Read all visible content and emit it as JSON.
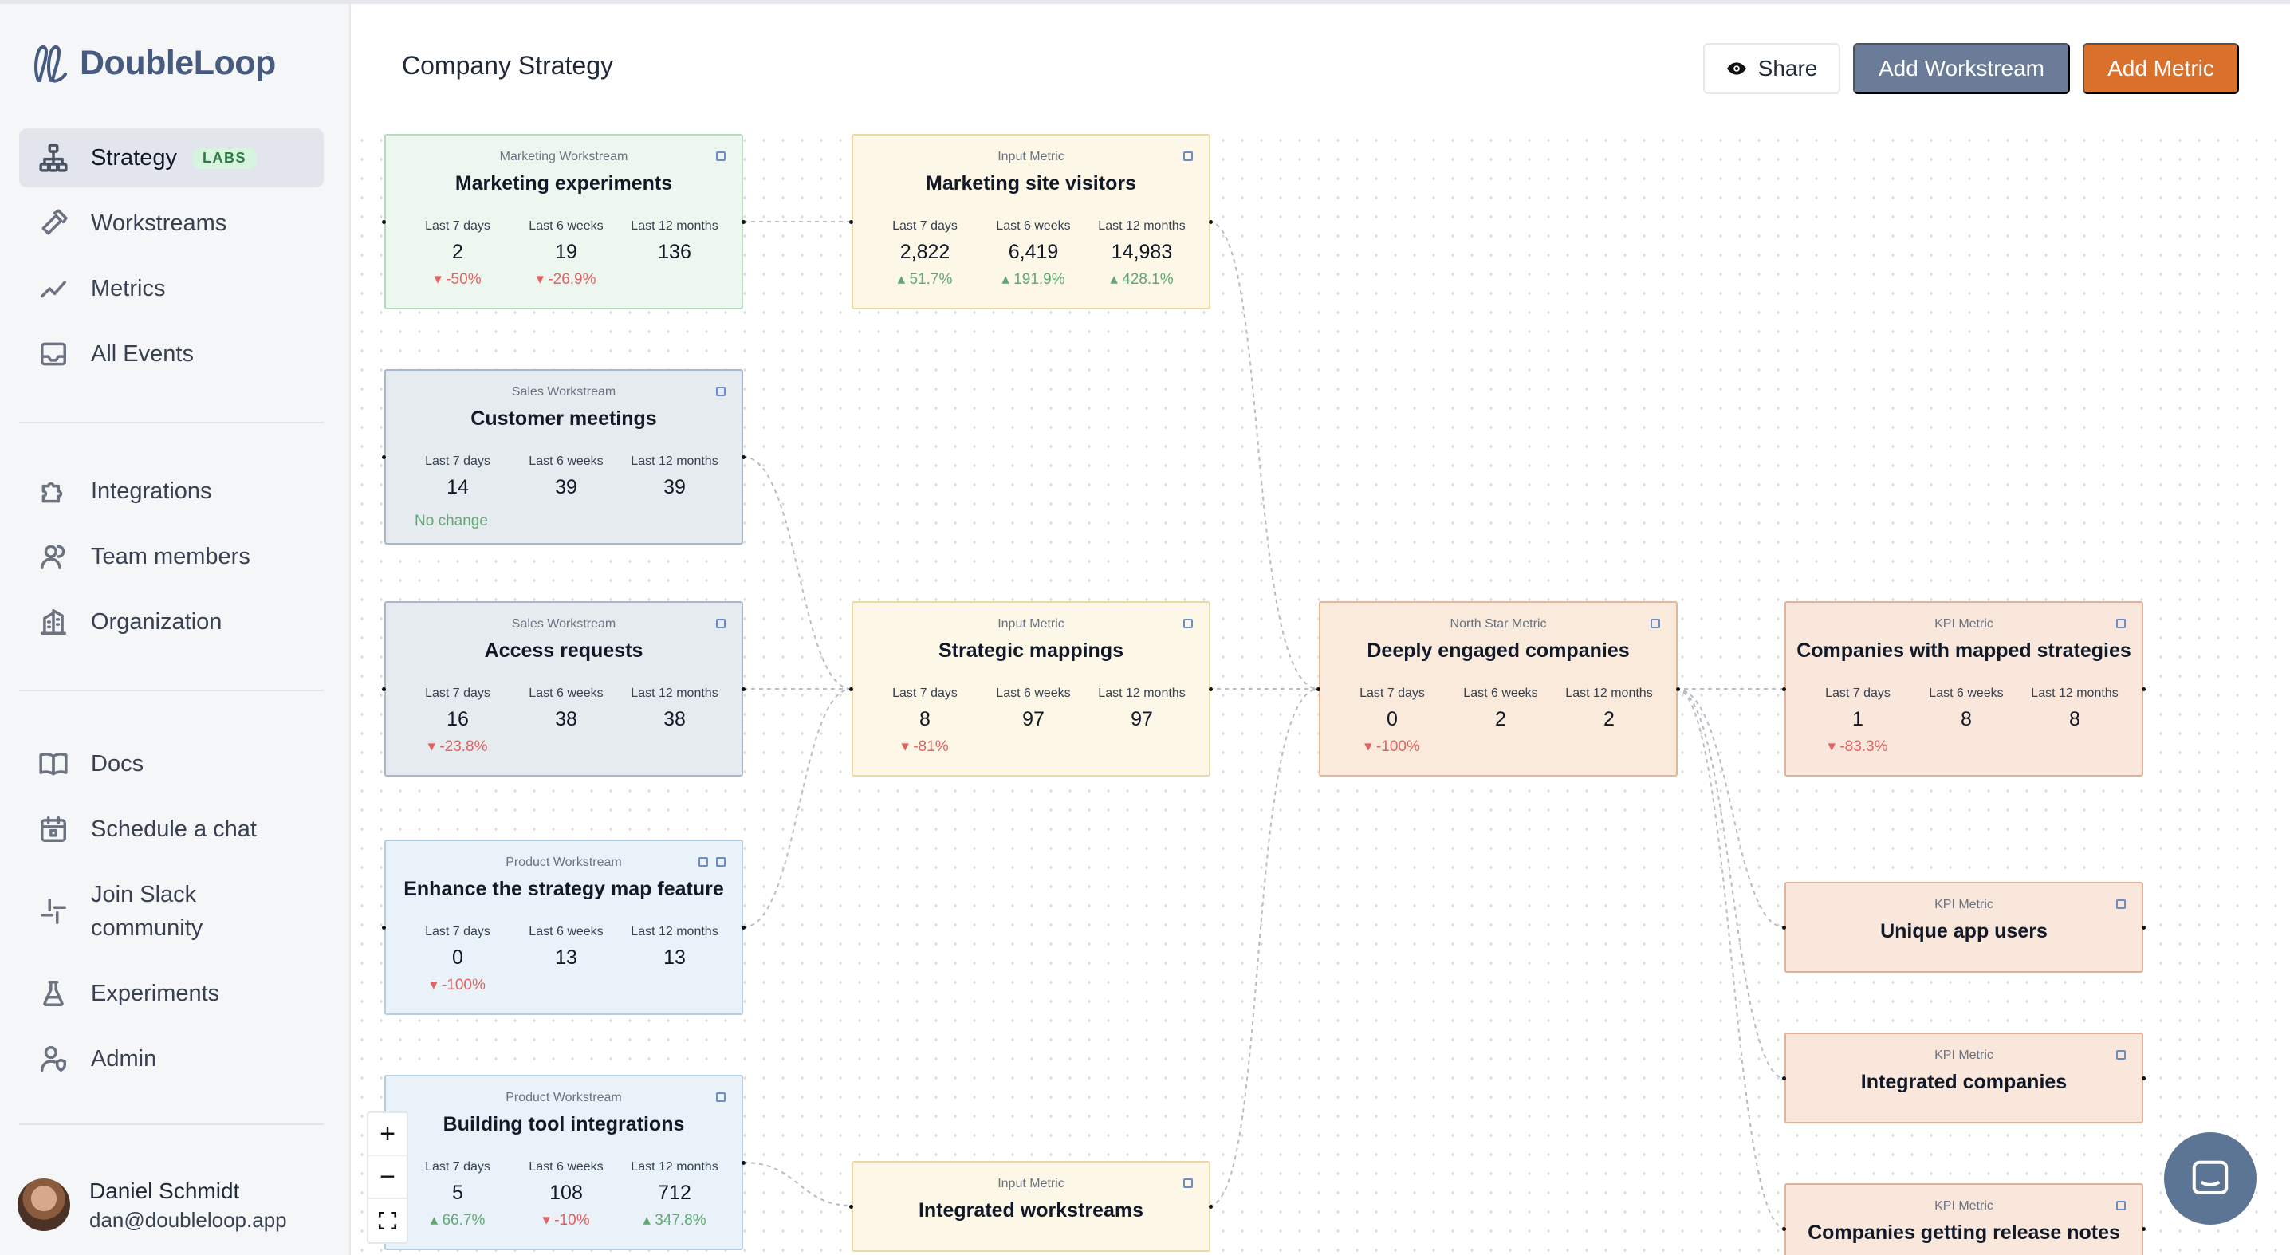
{
  "app": {
    "name": "DoubleLoop"
  },
  "sidebar": {
    "items": [
      {
        "label": "Strategy",
        "badge": "LABS",
        "icon": "hierarchy-icon",
        "active": true
      },
      {
        "label": "Workstreams",
        "icon": "hammer-icon"
      },
      {
        "label": "Metrics",
        "icon": "trend-line-icon"
      },
      {
        "label": "All Events",
        "icon": "inbox-icon"
      },
      {
        "label": "Integrations",
        "icon": "puzzle-icon"
      },
      {
        "label": "Team members",
        "icon": "users-icon"
      },
      {
        "label": "Organization",
        "icon": "building-icon"
      },
      {
        "label": "Docs",
        "icon": "book-icon"
      },
      {
        "label": "Schedule a chat",
        "icon": "calendar-icon"
      },
      {
        "label": "Join Slack community",
        "icon": "slack-icon"
      },
      {
        "label": "Experiments",
        "icon": "flask-icon"
      },
      {
        "label": "Admin",
        "icon": "user-shield-icon"
      }
    ],
    "user": {
      "name": "Daniel Schmidt",
      "email": "dan@doubleloop.app"
    }
  },
  "header": {
    "title": "Company Strategy",
    "share_label": "Share",
    "add_workstream_label": "Add Workstream",
    "add_metric_label": "Add Metric"
  },
  "stat_labels": [
    "Last 7 days",
    "Last 6 weeks",
    "Last 12 months"
  ],
  "nodes": {
    "marketing_experiments": {
      "type": "Marketing Workstream",
      "title": "Marketing experiments",
      "values": [
        "2",
        "19",
        "136"
      ],
      "changes": [
        "-50%",
        "-26.9%",
        ""
      ]
    },
    "marketing_site_visitors": {
      "type": "Input Metric",
      "title": "Marketing site visitors",
      "values": [
        "2,822",
        "6,419",
        "14,983"
      ],
      "changes": [
        "51.7%",
        "191.9%",
        "428.1%"
      ]
    },
    "customer_meetings": {
      "type": "Sales Workstream",
      "title": "Customer meetings",
      "values": [
        "14",
        "39",
        "39"
      ],
      "note": "No change"
    },
    "access_requests": {
      "type": "Sales Workstream",
      "title": "Access requests",
      "values": [
        "16",
        "38",
        "38"
      ],
      "changes": [
        "-23.8%",
        "",
        ""
      ]
    },
    "strategic_mappings": {
      "type": "Input Metric",
      "title": "Strategic mappings",
      "values": [
        "8",
        "97",
        "97"
      ],
      "changes": [
        "-81%",
        "",
        ""
      ]
    },
    "deeply_engaged": {
      "type": "North Star Metric",
      "title": "Deeply engaged companies",
      "values": [
        "0",
        "2",
        "2"
      ],
      "changes": [
        "-100%",
        "",
        ""
      ]
    },
    "companies_mapped": {
      "type": "KPI Metric",
      "title": "Companies with mapped strategies",
      "values": [
        "1",
        "8",
        "8"
      ],
      "changes": [
        "-83.3%",
        "",
        ""
      ]
    },
    "enhance_strategy": {
      "type": "Product Workstream",
      "title": "Enhance the strategy map feature",
      "values": [
        "0",
        "13",
        "13"
      ],
      "changes": [
        "-100%",
        "",
        ""
      ]
    },
    "unique_app_users": {
      "type": "KPI Metric",
      "title": "Unique app users"
    },
    "integrated_companies": {
      "type": "KPI Metric",
      "title": "Integrated companies"
    },
    "building_tool": {
      "type": "Product Workstream",
      "title": "Building tool integrations",
      "values": [
        "5",
        "108",
        "712"
      ],
      "changes": [
        "66.7%",
        "-10%",
        "347.8%"
      ]
    },
    "integrated_workstreams": {
      "type": "Input Metric",
      "title": "Integrated workstreams"
    },
    "release_notes": {
      "type": "KPI Metric",
      "title": "Companies getting release notes"
    }
  },
  "colors": {
    "accent_orange": "#d9702c",
    "workstream_button": "#6b7c99",
    "brand": "#475a80",
    "positive": "#5fa874",
    "negative": "#e06262"
  }
}
